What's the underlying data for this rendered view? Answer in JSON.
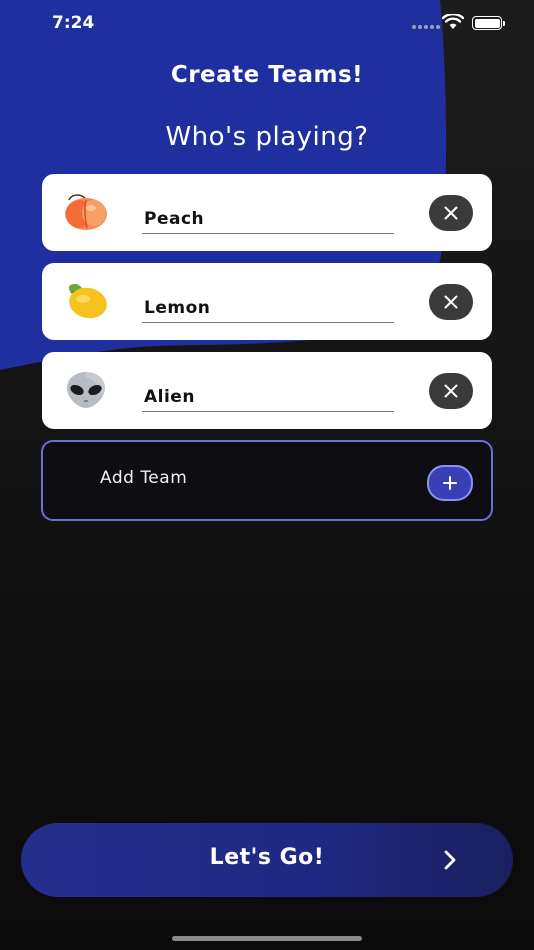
{
  "status_bar": {
    "time": "7:24"
  },
  "header": {
    "title": "Create Teams!",
    "subtitle": "Who's playing?"
  },
  "teams": [
    {
      "name": "Peach",
      "icon": "peach-icon"
    },
    {
      "name": "Lemon",
      "icon": "lemon-icon"
    },
    {
      "name": "Alien",
      "icon": "alien-icon"
    }
  ],
  "add_team": {
    "label": "Add Team"
  },
  "footer": {
    "go_label": "Let's Go!"
  },
  "colors": {
    "accent_blue": "#1f2fa0",
    "card_bg": "#ffffff",
    "remove_btn": "#3a3a3a",
    "add_border": "#6b6fd6"
  }
}
